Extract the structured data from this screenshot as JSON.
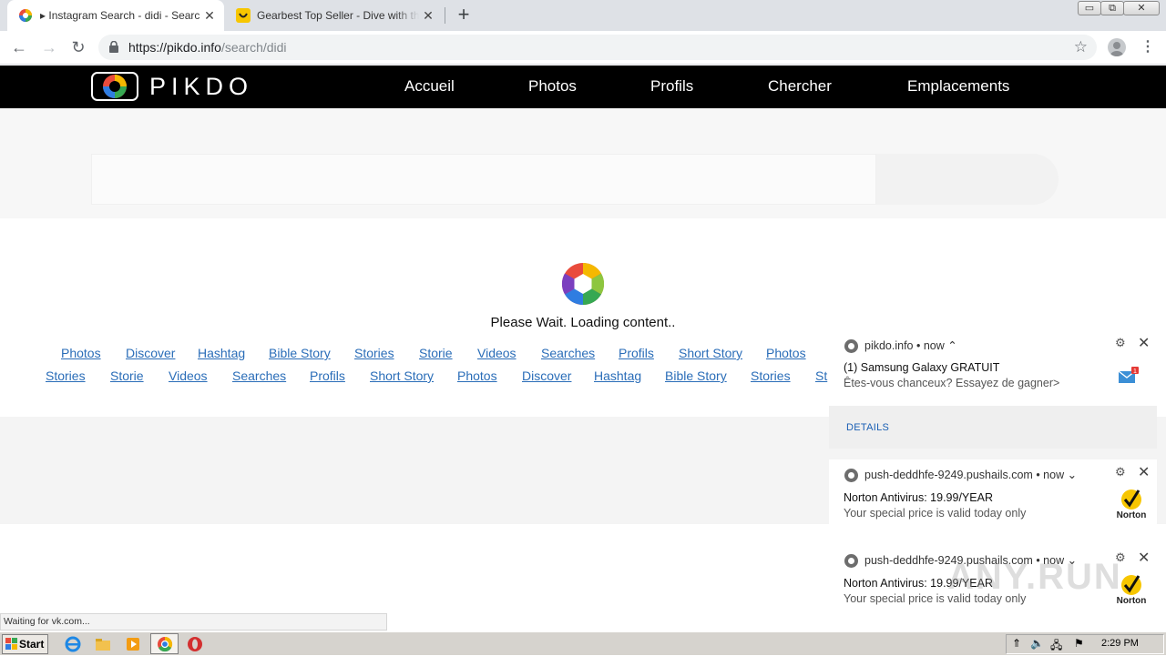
{
  "browser": {
    "tabs": [
      {
        "title": "▸ Instagram Search - didi - Search Instagram",
        "active": true
      },
      {
        "title": "Gearbest Top Seller - Dive with the Gearbest",
        "active": false
      }
    ],
    "new_tab": "+",
    "window_controls": {
      "minimize": "▭",
      "restore": "⧉",
      "close": "✕"
    },
    "url_host": "https://pikdo.info",
    "url_path": "/search/didi",
    "nav": {
      "back": "←",
      "forward": "→",
      "reload": "↻"
    },
    "star": "☆",
    "menu": "⋮"
  },
  "site": {
    "logo_text": "PIKDO",
    "nav": [
      "Accueil",
      "Photos",
      "Profils",
      "Chercher",
      "Emplacements"
    ]
  },
  "loading": {
    "text": "Please Wait. Loading content.."
  },
  "link_rows": [
    [
      "Photos",
      "Discover",
      "Hashtag",
      "Bible Story",
      "Stories",
      "Storie",
      "Videos",
      "Searches",
      "Profils",
      "Short Story",
      "Photos"
    ],
    [
      "Stories",
      "Storie",
      "Videos",
      "Searches",
      "Profils",
      "Short Story",
      "Photos",
      "Discover",
      "Hashtag",
      "Bible Story",
      "Stories",
      "St"
    ]
  ],
  "notifications": [
    {
      "source": "pikdo.info • now ⌃",
      "title": "(1) Samsung Galaxy GRATUIT",
      "body": "Êtes-vous chanceux? Essayez de gagner>",
      "action": "DETAILS",
      "badge_count": "1"
    },
    {
      "source": "push-deddhfe-9249.pushails.com • now ⌄",
      "title": "Norton Antivirus: 19.99/YEAR",
      "body": "Your special price is valid today only",
      "brand": "Norton"
    },
    {
      "source": "push-deddhfe-9249.pushails.com • now ⌄",
      "title": "Norton Antivirus: 19.99/YEAR",
      "body": "Your special price is valid today only",
      "brand": "Norton"
    }
  ],
  "notif_controls": {
    "gear": "⚙",
    "close": "✕"
  },
  "watermark": "ANY.RUN",
  "status_text": "Waiting for vk.com...",
  "taskbar": {
    "start_label": "Start",
    "clock": "2:29 PM"
  },
  "colors": {
    "header_bg": "#000000",
    "link": "#2a6db8",
    "details_link": "#1a5fb4"
  }
}
